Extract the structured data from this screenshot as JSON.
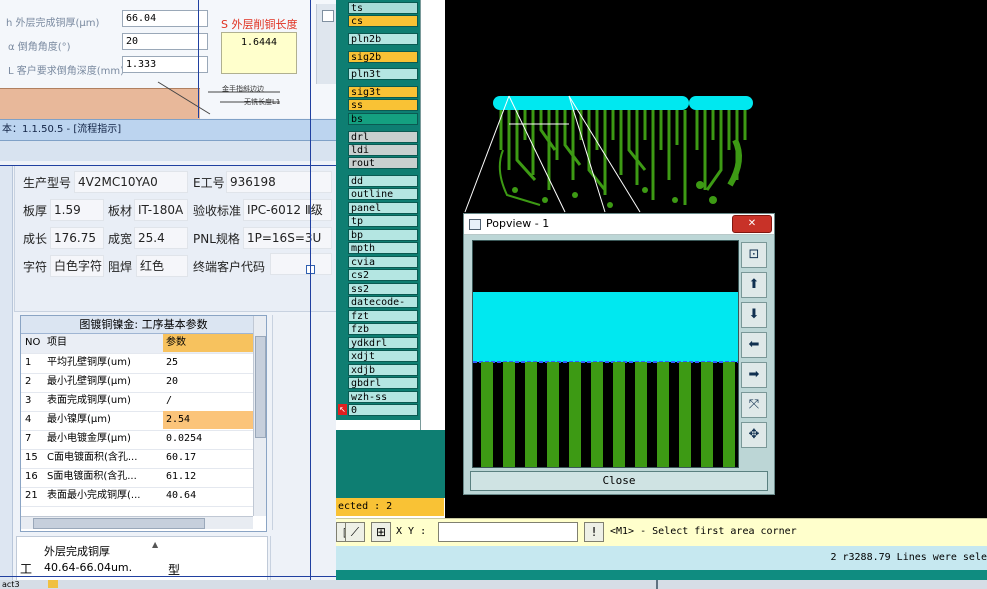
{
  "calc": {
    "outer_thickness_label": "h 外层完成铜厚(μm)",
    "outer_thickness_value": "66.04",
    "bevel_angle_label": "α 倒角角度(°)",
    "bevel_angle_value": "20",
    "depth_label": "L 客户要求倒角深度(mm)",
    "depth_value": "1.333",
    "result_label": "S 外层削铜长度",
    "result_value": "1.6444",
    "drawing_label_1": "金手指斜边边",
    "drawing_label_2": "无铣长度L1"
  },
  "flow_window": {
    "title": "本：1.1.50.5 - [流程指示]"
  },
  "info": {
    "model_label": "生产型号",
    "model_value": "4V2MC10YA0",
    "eno_label": "E工号",
    "eno_value": "936198",
    "thickness_label": "板厚",
    "thickness_value": "1.59",
    "material_label": "板材",
    "material_value": "IT-180A",
    "standard_label": "验收标准",
    "standard_value": "IPC-6012 Ⅱ级",
    "length_label": "成长",
    "length_value": "176.75",
    "width_label": "成宽",
    "width_value": "25.4",
    "pnl_label": "PNL规格",
    "pnl_value": "1P=16S=3U",
    "char_label": "字符",
    "char_value": "白色字符",
    "mask_label": "阻焊",
    "mask_value": "红色",
    "customer_label": "终端客户代码",
    "customer_value": ""
  },
  "grid": {
    "caption": "图镀铜镍金: 工序基本参数",
    "headers": [
      "NO",
      "项目",
      "参数"
    ],
    "rows": [
      {
        "no": "1",
        "item": "平均孔壁铜厚(um)",
        "value": "25"
      },
      {
        "no": "2",
        "item": "最小孔壁铜厚(μm)",
        "value": "20"
      },
      {
        "no": "3",
        "item": "表面完成铜厚(um)",
        "value": "/"
      },
      {
        "no": "4",
        "item": "最小镍厚(μm)",
        "value": "2.54"
      },
      {
        "no": "7",
        "item": "最小电镀金厚(μm)",
        "value": "0.0254"
      },
      {
        "no": "15",
        "item": "C面电镀面积(含孔...",
        "value": "60.17"
      },
      {
        "no": "16",
        "item": "S面电镀面积(含孔...",
        "value": "61.12"
      },
      {
        "no": "21",
        "item": "表面最小完成铜厚(...",
        "value": "40.64"
      }
    ]
  },
  "note": {
    "prefix": "工",
    "title": "外层完成铜厚",
    "value": "40.64-66.04um.",
    "side": "型"
  },
  "layers": [
    "ts",
    "cs",
    "pln2b",
    "sig2b",
    "pln3t",
    "sig3t",
    "ss",
    "bs",
    "drl",
    "ldi",
    "rout",
    "dd",
    "outline",
    "panel",
    "tp",
    "bp",
    "mpth",
    "cvia",
    "cs2",
    "ss2",
    "datecode-ss",
    "fzt",
    "fzb",
    "ydkdrl",
    "xdjt",
    "xdjb",
    "gbdrl",
    "wzh-ss",
    "0"
  ],
  "popview": {
    "title": "Popview - 1",
    "close_label": "Close"
  },
  "bottom": {
    "selected_text": "ected : 2",
    "xy_label": "X Y :",
    "xy_value": "",
    "prompt_text": "<M1> - Select first area corner",
    "status_text": "2 r3288.79 Lines were sele",
    "taskbar_text": "act3"
  },
  "colors": {
    "cyan": "#00e8f0",
    "trace_green": "#3d9a14",
    "orange_layer": "#f9c235",
    "teal": "#0e7e72"
  }
}
